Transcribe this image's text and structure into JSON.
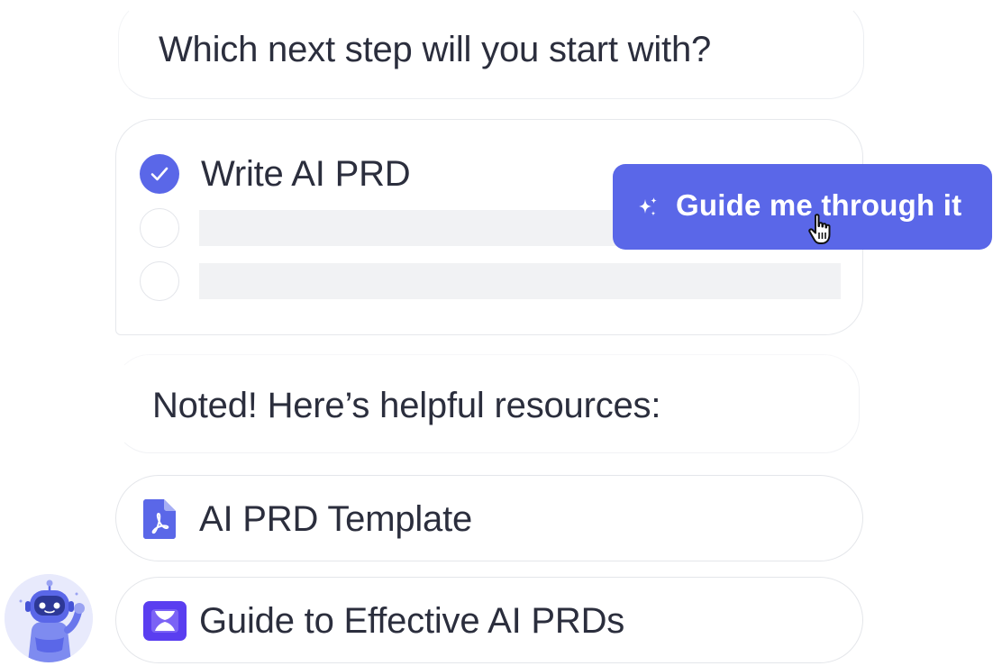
{
  "question": {
    "text": "Which next step will you start with?"
  },
  "options": [
    {
      "label": "Write AI PRD",
      "checked": true
    },
    {
      "label": "",
      "checked": false
    },
    {
      "label": "",
      "checked": false
    }
  ],
  "guide_button": {
    "label": "Guide me through it",
    "icon": "sparkle-icon"
  },
  "answer": {
    "text": "Noted! Here’s helpful resources:"
  },
  "resources": [
    {
      "label": "AI PRD Template",
      "icon": "pdf-file-icon"
    },
    {
      "label": "Guide to Effective AI PRDs",
      "icon": "guide-book-icon"
    }
  ],
  "avatar": {
    "icon": "robot-avatar-icon"
  },
  "colors": {
    "accent": "#5a67e8",
    "text": "#2b2e3d",
    "placeholder": "#f1f2f4",
    "border": "#e4e6ea"
  }
}
